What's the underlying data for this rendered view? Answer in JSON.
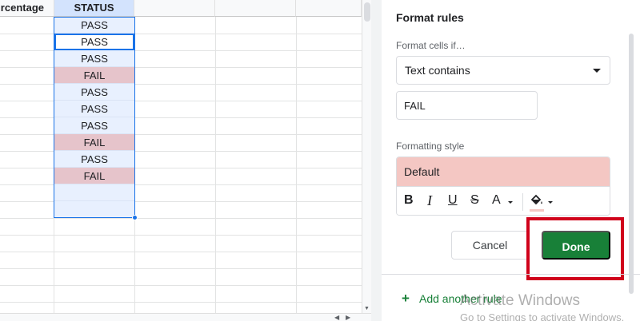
{
  "sheet": {
    "headers": {
      "col_a": "rcentage",
      "col_b": "STATUS"
    },
    "status_cells": [
      "PASS",
      "PASS",
      "PASS",
      "FAIL",
      "PASS",
      "PASS",
      "PASS",
      "FAIL",
      "PASS",
      "FAIL",
      "",
      ""
    ]
  },
  "panel": {
    "title": "Format rules",
    "format_cells_label": "Format cells if…",
    "condition_value": "Text contains",
    "value_input": "FAIL",
    "formatting_style_label": "Formatting style",
    "style_preview": "Default",
    "toolbar": {
      "bold": "B",
      "italic": "I",
      "underline": "U",
      "strikethrough": "S",
      "text_color": "A"
    },
    "cancel_label": "Cancel",
    "done_label": "Done",
    "add_rule_icon": "+",
    "add_rule_label": "Add another rule"
  },
  "watermark": {
    "title": "Activate Windows",
    "subtitle": "Go to Settings to activate Windows."
  },
  "colors": {
    "fail_fill": "#e6c4cb",
    "selection": "#1a73e8",
    "style_preview": "#f4c7c3",
    "done_button": "#188038",
    "highlight": "#d0021b"
  }
}
